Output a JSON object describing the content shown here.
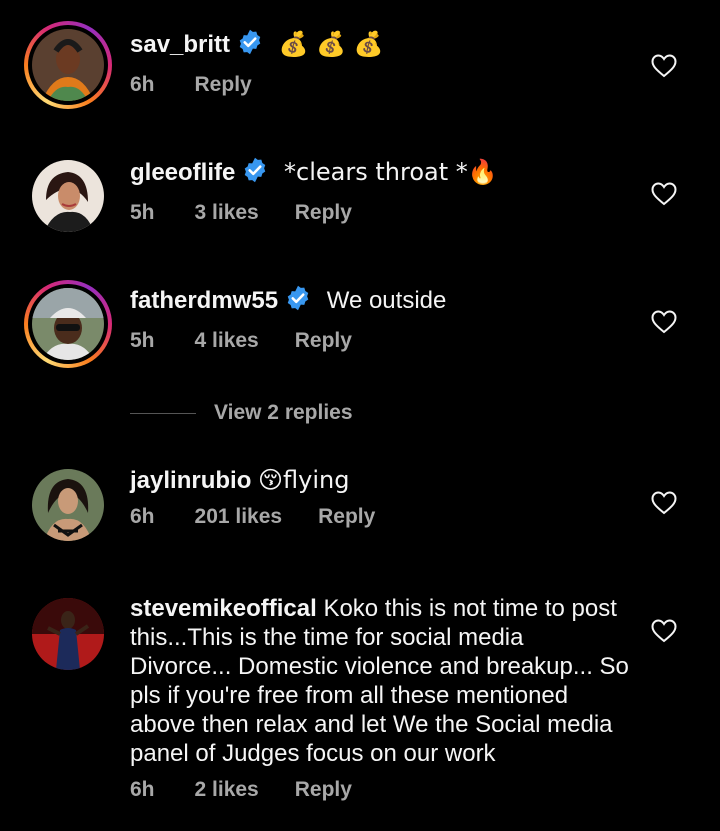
{
  "comments": [
    {
      "username": "sav_britt",
      "verified": true,
      "text": "💰 💰 💰",
      "time": "6h",
      "likes": "",
      "reply": "Reply",
      "story_ring": true
    },
    {
      "username": "gleeoflife",
      "verified": true,
      "text": "*clears throat *🔥",
      "time": "5h",
      "likes": "3 likes",
      "reply": "Reply",
      "story_ring": false
    },
    {
      "username": "fatherdmw55",
      "verified": true,
      "text": "We outside",
      "time": "5h",
      "likes": "4 likes",
      "reply": "Reply",
      "story_ring": true
    },
    {
      "username": "jaylinrubio",
      "verified": false,
      "text": "😚flying",
      "time": "6h",
      "likes": "201 likes",
      "reply": "Reply",
      "story_ring": false
    },
    {
      "username": "stevemikeoffical",
      "verified": false,
      "text": "Koko this is not time to post this...This is the time for social media Divorce... Domestic violence and breakup... So pls if you're free from all these mentioned above then relax and let We the Social media panel of Judges focus on our work",
      "time": "6h",
      "likes": "2 likes",
      "reply": "Reply",
      "story_ring": false
    }
  ],
  "view_replies": "View 2 replies",
  "icons": {
    "like": "heart-outline-icon",
    "verified": "verified-badge-icon"
  },
  "colors": {
    "background": "#000000",
    "text": "#f5f5f5",
    "secondary": "#a8a8a8",
    "verified": "#3897f0"
  }
}
